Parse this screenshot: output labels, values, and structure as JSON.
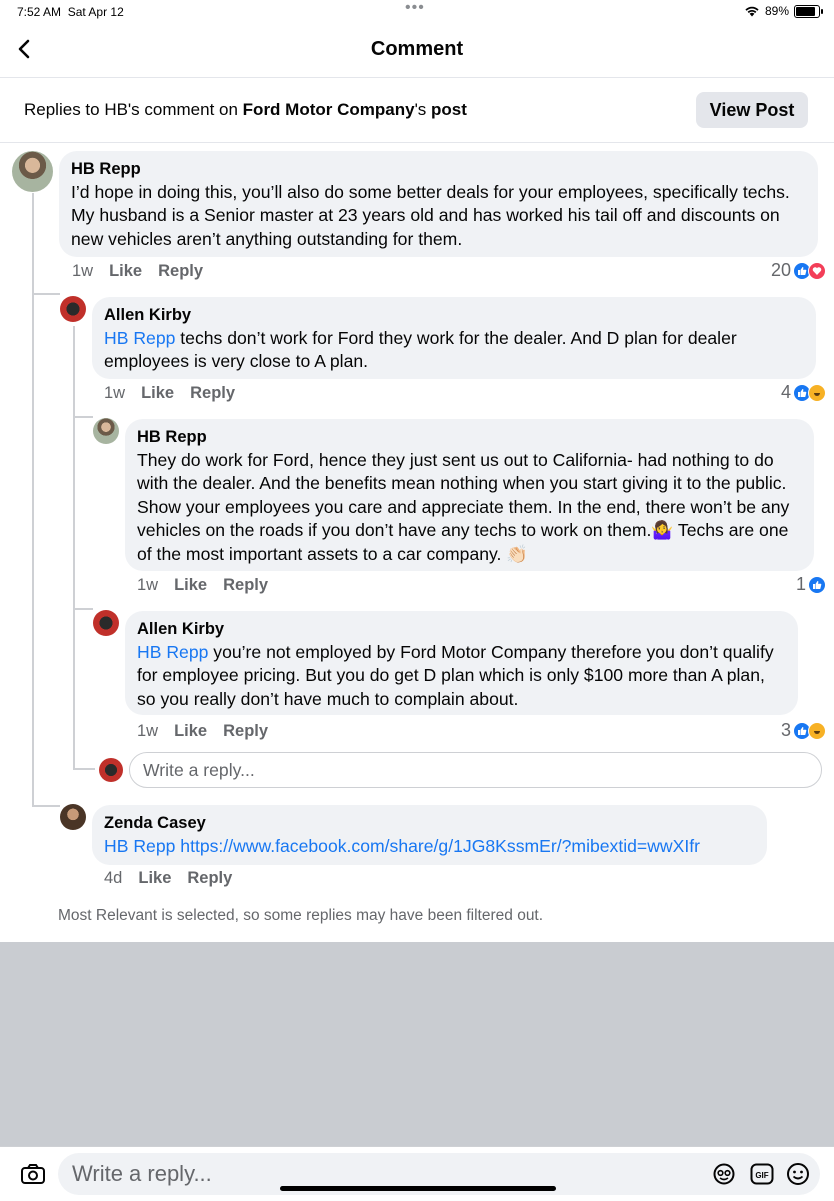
{
  "status_bar": {
    "time": "7:52 AM",
    "date": "Sat Apr 12",
    "battery": "89%"
  },
  "nav": {
    "title": "Comment",
    "back_icon": "chevron-left-icon"
  },
  "subheader": {
    "prefix": "Replies to HB's comment on ",
    "page_name": "Ford Motor Company",
    "suffix": "'s ",
    "post_word": "post",
    "view_post_label": "View Post"
  },
  "comments": [
    {
      "name": "HB Repp",
      "mention": "",
      "text": "I’d hope in doing this, you’ll also do some better deals for your employees, specifically techs. My husband is a Senior master at 23 years old and has worked his tail off and discounts on new vehicles aren’t anything outstanding for them.",
      "time": "1w",
      "like": "Like",
      "reply": "Reply",
      "reaction_count": "20",
      "reactions": [
        "like",
        "love"
      ]
    },
    {
      "name": "Allen Kirby",
      "mention": "HB Repp",
      "text": " techs don’t work for Ford they work for the dealer.  And D plan for dealer employees is very close to A plan.",
      "time": "1w",
      "like": "Like",
      "reply": "Reply",
      "reaction_count": "4",
      "reactions": [
        "like",
        "haha"
      ]
    },
    {
      "name": "HB Repp",
      "mention": "",
      "text": "They do work for Ford, hence they just sent us out to California- had nothing to do with the dealer. And the benefits mean nothing when you start giving it to the public. Show your employees you care and appreciate them. In the end, there won’t be any vehicles on the roads if you don’t have any techs to work on them.🤷‍♀️ Techs are one of the most important assets to a car company. 👏🏻",
      "time": "1w",
      "like": "Like",
      "reply": "Reply",
      "reaction_count": "1",
      "reactions": [
        "like"
      ]
    },
    {
      "name": "Allen Kirby",
      "mention": "HB Repp",
      "text": " you’re not employed by Ford Motor Company therefore you don’t qualify for employee pricing.  But you do get D plan which is only $100 more than A plan, so you really don’t have much to complain about.",
      "time": "1w",
      "like": "Like",
      "reply": "Reply",
      "reaction_count": "3",
      "reactions": [
        "like",
        "haha"
      ]
    },
    {
      "name": "Zenda Casey",
      "mention": "HB Repp",
      "text": " https://www.facebook.com/share/g/1JG8KssmEr/?mibextid=wwXIfr",
      "time": "4d",
      "like": "Like",
      "reply": "Reply",
      "reaction_count": "",
      "reactions": []
    }
  ],
  "inline_reply_placeholder": "Write a reply...",
  "filter_note": "Most Relevant is selected, so some replies may have been filtered out.",
  "composer": {
    "placeholder": "Write a reply...",
    "icons": [
      "camera-icon",
      "avatar-sticker-icon",
      "gif-icon",
      "emoji-icon"
    ]
  },
  "colors": {
    "link": "#1877f2",
    "bubble": "#f0f2f5",
    "muted": "#65676b",
    "like": "#1877f2",
    "love": "#f33e58",
    "haha": "#f7b125"
  }
}
